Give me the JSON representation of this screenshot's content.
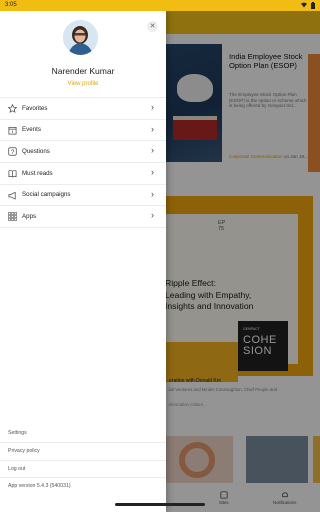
{
  "status_bar": {
    "time": "3:05"
  },
  "drawer": {
    "user_name": "Narender Kumar",
    "view_profile": "View profile",
    "menu": [
      {
        "label": "Favorites",
        "icon": "star-icon"
      },
      {
        "label": "Events",
        "icon": "calendar-icon"
      },
      {
        "label": "Questions",
        "icon": "question-icon"
      },
      {
        "label": "Must reads",
        "icon": "book-icon"
      },
      {
        "label": "Social campaigns",
        "icon": "megaphone-icon"
      },
      {
        "label": "Apps",
        "icon": "grid-icon"
      }
    ],
    "footer": {
      "settings": "Settings",
      "privacy": "Privacy policy",
      "logout": "Log out",
      "version": "App version 5.4.3 (540031)"
    }
  },
  "background": {
    "article": {
      "title": "India Employee Stock Option Plan (ESOP)",
      "desc": "The Employee Stock Option Plan (ESOP) is the option or scheme which is being offered by Genpact Ind...",
      "meta_source": "Corporate Communication",
      "meta_date": "on Jan 18..."
    },
    "podcast": {
      "episode": "EP\n75",
      "title_lines": [
        "Ripple Effect:",
        "Leading with Empathy,",
        "Insights and Innovation"
      ],
      "cohesion_small": "GENPACT",
      "cohesion_word": "COHE\nSION",
      "caption": "...eration with Donald Kni",
      "caption2": "...ital Ventures and Miriam Connaughton, Chief People and",
      "caption3": "...nformation culture..."
    },
    "nav": {
      "item1": "Sites",
      "item2": "Notifications"
    }
  },
  "colors": {
    "accent": "#f2bd12",
    "link": "#e2a500"
  }
}
